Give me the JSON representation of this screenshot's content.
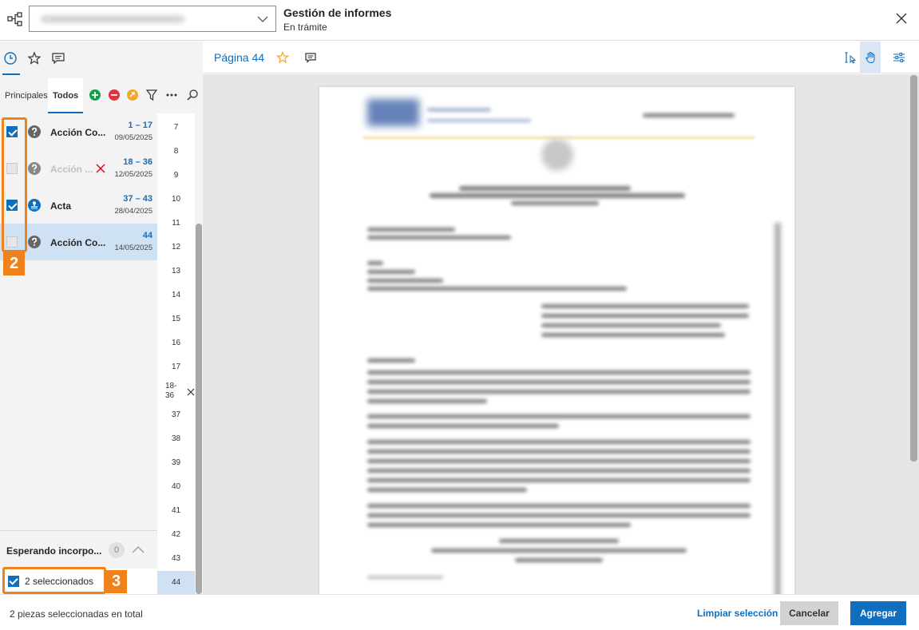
{
  "header": {
    "title": "Gestión de informes",
    "subtitle": "En trámite"
  },
  "left": {
    "tabs": [
      {
        "label": "Principales"
      },
      {
        "label": "Todos"
      }
    ],
    "documents": [
      {
        "name": "Acción Co...",
        "range": "1 – 17",
        "date": "09/05/2025",
        "checked": true
      },
      {
        "name": "Acción ...",
        "range": "18 – 36",
        "date": "12/05/2025",
        "checked": false,
        "removed": true
      },
      {
        "name": "Acta",
        "range": "37 – 43",
        "date": "28/04/2025",
        "checked": true
      },
      {
        "name": "Acción Co...",
        "range": "44",
        "date": "14/05/2025",
        "checked": false,
        "selected": true
      }
    ],
    "pages": [
      "7",
      "8",
      "9",
      "10",
      "11",
      "12",
      "13",
      "14",
      "15",
      "16",
      "17",
      "18-\n36",
      "37",
      "38",
      "39",
      "40",
      "41",
      "42",
      "43",
      "44"
    ],
    "waiting": {
      "label": "Esperando incorpo...",
      "count": "0"
    },
    "selected_summary": "2 seleccionados"
  },
  "callouts": {
    "two": "2",
    "three": "3"
  },
  "viewer": {
    "page_title": "Página 44"
  },
  "footer": {
    "status": "2 piezas seleccionadas en total",
    "clear": "Limpiar selección",
    "cancel": "Cancelar",
    "add": "Agregar"
  },
  "colors": {
    "accent": "#106ebe",
    "callout": "#f0821e",
    "danger": "#e0001b",
    "add_icon": "#1a9e48",
    "remove_icon": "#e0333f",
    "swap_icon": "#f4a52b"
  }
}
